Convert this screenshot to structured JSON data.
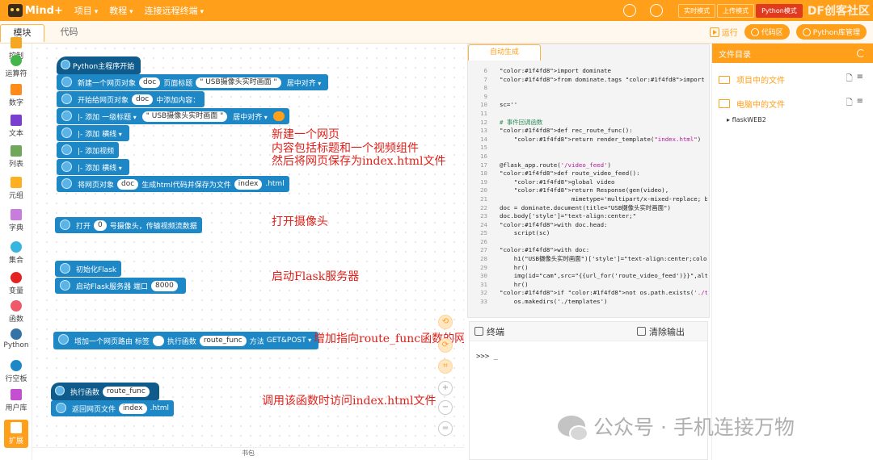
{
  "app": {
    "name": "Mind+"
  },
  "topbar": {
    "menu": [
      "项目",
      "教程",
      "连接远程终端"
    ],
    "modes": [
      "实时模式",
      "上传模式",
      "Python模式"
    ],
    "brand": "DF创客社区"
  },
  "tabs": {
    "blocks": "模块",
    "code": "代码"
  },
  "toolbar": {
    "run": "运行",
    "btn1": "代码区",
    "btn2": "Python库管理"
  },
  "sidebar": {
    "items": [
      {
        "label": "控制",
        "color": "#f5a623",
        "shape": "sq"
      },
      {
        "label": "运算符",
        "color": "#44b649",
        "shape": "dot"
      },
      {
        "label": "数字",
        "color": "#ff8c1a",
        "shape": "sq"
      },
      {
        "label": "文本",
        "color": "#7a3fd0",
        "shape": "sq"
      },
      {
        "label": "列表",
        "color": "#6fa85a",
        "shape": "sq"
      },
      {
        "label": "元组",
        "color": "#ffb020",
        "shape": "sq"
      },
      {
        "label": "字典",
        "color": "#c67ddb",
        "shape": "sq"
      },
      {
        "label": "集合",
        "color": "#36b5e0",
        "shape": "dot"
      },
      {
        "label": "变量",
        "color": "#e52222",
        "shape": "dot"
      },
      {
        "label": "函数",
        "color": "#ef5a6a",
        "shape": "dot"
      },
      {
        "label": "Python",
        "color": "#3572a5",
        "shape": "dot"
      },
      {
        "label": "行空板",
        "color": "#1e88c7",
        "shape": "dot"
      },
      {
        "label": "用户库",
        "color": "#c44fd0",
        "shape": "sq"
      },
      {
        "label": "扩展",
        "color": "#ffffff",
        "shape": "sq"
      }
    ]
  },
  "blocks": {
    "hat": "Python主程序开始",
    "b1": {
      "pre": "新建一个网页对象",
      "var": "doc",
      "mid": "页面标题",
      "title": "\" USB摄像头实时画面 \"",
      "align": "居中对齐"
    },
    "b2": {
      "pre": "开始给网页对象",
      "var": "doc",
      "post": "中添加内容："
    },
    "b3": {
      "pre": "|- 添加",
      "level": "一级标题",
      "text": "\" USB摄像头实时画面 \"",
      "align": "居中对齐"
    },
    "b4": {
      "pre": "|- 添加",
      "item": "横线"
    },
    "b5": {
      "pre": "|- 添加视频"
    },
    "b6": {
      "pre": "|- 添加",
      "item": "横线"
    },
    "b7": {
      "pre": "将网页对象",
      "var": "doc",
      "mid": "生成html代码并保存为文件",
      "file": "index",
      "post": ".html"
    },
    "b8": {
      "pre": "打开",
      "num": "0",
      "post": "号摄像头，传输视频流数据"
    },
    "b9": {
      "text": "初始化Flask"
    },
    "b10": {
      "pre": "启动Flask服务器 端口",
      "port": "8000"
    },
    "b11": {
      "pre": "增加一个网页路由 标签",
      "mid": "执行函数",
      "func": "route_func",
      "method_label": "方法",
      "method": "GET&POST"
    },
    "b12": {
      "pre": "执行函数",
      "func": "route_func"
    },
    "b13": {
      "pre": "返回网页文件",
      "file": "index",
      "post": ".html"
    }
  },
  "annotations": {
    "a1": "新建一个网页",
    "a2": "内容包括标题和一个视频组件",
    "a3": "然后将网页保存为index.html文件",
    "a4": "打开摄像头",
    "a5": "启动Flask服务器",
    "a6": "增加指向route_func函数的网页路由",
    "a7": "调用该函数时访问index.html文件"
  },
  "workspace_bottom": "书包",
  "code_panel": {
    "tab": "自动生成",
    "lines": [
      {
        "n": "6",
        "t": "import dominate"
      },
      {
        "n": "7",
        "t": "from dominate.tags import *"
      },
      {
        "n": "8",
        "t": ""
      },
      {
        "n": "9",
        "t": ""
      },
      {
        "n": "10",
        "t": "sc=''"
      },
      {
        "n": "11",
        "t": ""
      },
      {
        "n": "12",
        "t": "# 事件回调函数"
      },
      {
        "n": "13",
        "t": "def rec_route_func():"
      },
      {
        "n": "14",
        "t": "    return render_template(\"index.html\")"
      },
      {
        "n": "15",
        "t": ""
      },
      {
        "n": "16",
        "t": ""
      },
      {
        "n": "17",
        "t": "@flask_app.route('/video_feed')"
      },
      {
        "n": "18",
        "t": "def route_video_feed():"
      },
      {
        "n": "19",
        "t": "    global video"
      },
      {
        "n": "20",
        "t": "    return Response(gen(video),"
      },
      {
        "n": "21",
        "t": "                    mimetype='multipart/x-mixed-replace; bou"
      },
      {
        "n": "22",
        "t": "doc = dominate.document(title=\"USB摄像头实时画面\")"
      },
      {
        "n": "23",
        "t": "doc.body['style']=\"text-align:center;\""
      },
      {
        "n": "24",
        "t": "with doc.head:"
      },
      {
        "n": "25",
        "t": "    script(sc)"
      },
      {
        "n": "26",
        "t": ""
      },
      {
        "n": "27",
        "t": "with doc:"
      },
      {
        "n": "28",
        "t": "    h1(\"USB摄像头实时画面\")['style']=\"text-align:center;color"
      },
      {
        "n": "29",
        "t": "    hr()"
      },
      {
        "n": "30",
        "t": "    img(id=\"cam\",src=\"{{url_for('route_video_feed')}}\",alt='"
      },
      {
        "n": "31",
        "t": "    hr()"
      },
      {
        "n": "32",
        "t": "if not os.path.exists('./templates'):"
      },
      {
        "n": "33",
        "t": "    os.makedirs('./templates')"
      }
    ]
  },
  "terminal": {
    "title": "终端",
    "clear": "清除输出",
    "prompt": ">>> _"
  },
  "files": {
    "title": "文件目录",
    "project": "项目中的文件",
    "computer": "电脑中的文件",
    "tree_item": "flaskWEB2"
  },
  "watermark": "公众号 · 手机连接万物"
}
